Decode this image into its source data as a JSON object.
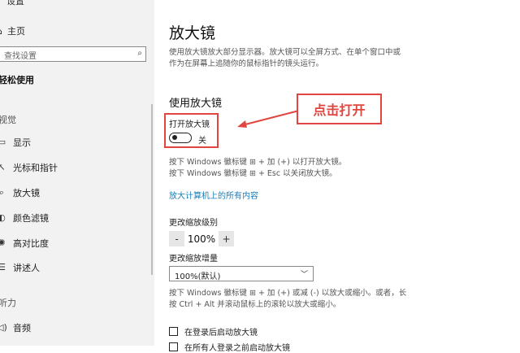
{
  "sidebar": {
    "top_text": "设置",
    "home_label": "主页",
    "search_placeholder": "查找设置",
    "section_title": "轻松使用",
    "category_vision": "视觉",
    "items": [
      {
        "label": "显示",
        "icon": "monitor-icon"
      },
      {
        "label": "光标和指针",
        "icon": "cursor-icon"
      },
      {
        "label": "放大镜",
        "icon": "magnifier-icon"
      },
      {
        "label": "颜色滤镜",
        "icon": "color-filter-icon"
      },
      {
        "label": "高对比度",
        "icon": "contrast-icon"
      },
      {
        "label": "讲述人",
        "icon": "narrator-icon"
      }
    ],
    "category_hearing": "听力",
    "audio_label": "音频"
  },
  "main": {
    "title": "放大镜",
    "description": "使用放大镜放大部分显示器。放大镜可以全屏方式、在单个窗口中或作为在屏幕上追随你的鼠标指针的镜头运行。",
    "section_title": "使用放大镜",
    "toggle_label": "打开放大镜",
    "toggle_state": "关",
    "callout": "点击打开",
    "hint_open": "按下 Windows 徽标键 ⊞ + 加 (+) 以打开放大镜。",
    "hint_close": "按下 Windows 徽标键 ⊞ + Esc 以关闭放大镜。",
    "link": "放大计算机上的所有内容",
    "zoom_level_label": "更改缩放级别",
    "zoom_minus": "-",
    "zoom_value": "100%",
    "zoom_plus": "+",
    "increment_label": "更改缩放增量",
    "increment_value": "100%(默认)",
    "zoom_hint": "按下 Windows 徽标键 ⊞ + 加 (+) 或减 (-) 以放大或缩小。或者，长按 Ctrl + Alt 并滚动鼠标上的滚轮以放大或缩小。",
    "checkbox_login": "在登录后启动放大镜",
    "checkbox_all": "在所有人登录之前启动放大镜"
  },
  "colors": {
    "accent": "#1a7db8",
    "highlight": "#e0463f"
  }
}
